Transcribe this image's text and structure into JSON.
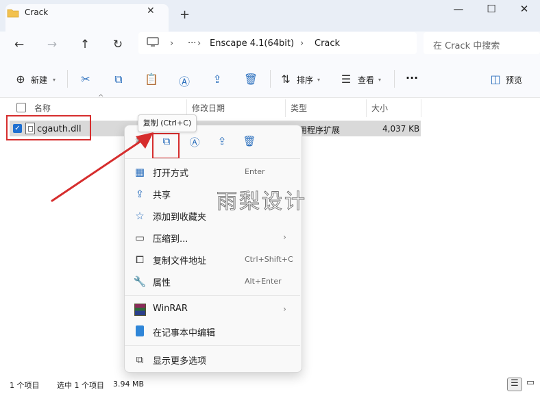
{
  "window": {
    "tab_title": "Crack",
    "new_tab": "+",
    "minimize": "—",
    "maximize": "☐",
    "close": "✕"
  },
  "nav": {
    "back": "←",
    "forward": "→",
    "up": "↑",
    "refresh": "↻",
    "more": "···",
    "breadcrumb": [
      "Enscape 4.1(64bit)",
      "Crack"
    ],
    "search_placeholder": "在 Crack 中搜索"
  },
  "toolbar": {
    "new_label": "新建",
    "sort_label": "排序",
    "view_label": "查看",
    "more": "···",
    "preview_label": "预览"
  },
  "columns": [
    "名称",
    "修改日期",
    "类型",
    "大小"
  ],
  "file": {
    "name": "cgauth.dll",
    "type": "应用程序扩展",
    "size": "4,037 KB"
  },
  "tooltip": "复制 (Ctrl+C)",
  "context_menu": {
    "items": [
      {
        "label": "打开方式",
        "shortcut": "Enter"
      },
      {
        "label": "共享",
        "shortcut": ""
      },
      {
        "label": "添加到收藏夹",
        "shortcut": ""
      },
      {
        "label": "压缩到...",
        "shortcut": ""
      },
      {
        "label": "复制文件地址",
        "shortcut": "Ctrl+Shift+C"
      },
      {
        "label": "属性",
        "shortcut": "Alt+Enter"
      },
      {
        "label": "WinRAR",
        "shortcut": ""
      },
      {
        "label": "在记事本中编辑",
        "shortcut": ""
      },
      {
        "label": "显示更多选项",
        "shortcut": ""
      }
    ]
  },
  "watermark": "雨梨设计",
  "status": {
    "count": "1 个项目",
    "selected": "选中 1 个项目",
    "selected_size": "3.94 MB"
  },
  "colors": {
    "accent": "#1f6fd0",
    "highlight_box": "#d62d2d",
    "arrow": "#d62d2d",
    "selection": "#d9d9d9"
  }
}
